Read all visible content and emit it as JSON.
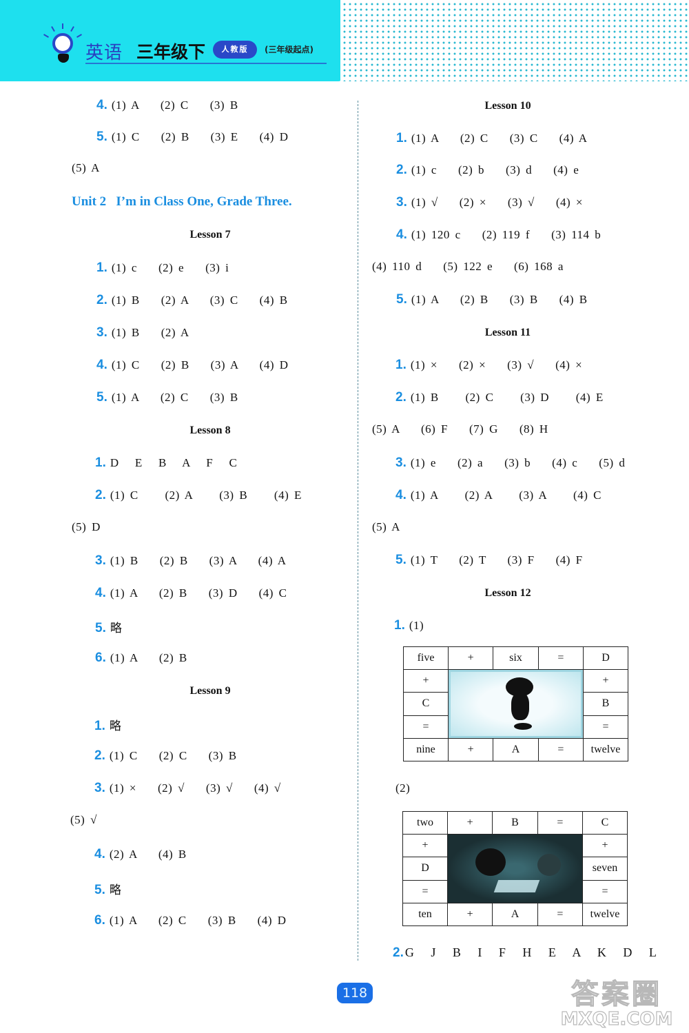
{
  "header": {
    "subject": "英语",
    "grade": "三年级下",
    "edition_badge": "人教版",
    "edition_note": "(三年级起点)",
    "icon": "lightbulb-icon",
    "brand_color": "#1ee0ee",
    "accent_color": "#2a48c8"
  },
  "left": {
    "prev_items": [
      {
        "num": "4.",
        "answer": "(1) A    (2) C    (3) B"
      },
      {
        "num": "5.",
        "answer": "(1) C    (2) B    (3) E    (4) D"
      },
      {
        "num": "",
        "answer": "(5) A"
      }
    ],
    "unit_title": "Unit 2   I’m in Class One, Grade Three.",
    "lesson7": {
      "title": "Lesson 7",
      "items": [
        {
          "num": "1.",
          "answer": "(1) c    (2) e    (3) i"
        },
        {
          "num": "2.",
          "answer": "(1) B    (2) A    (3) C    (4) B"
        },
        {
          "num": "3.",
          "answer": "(1) B    (2) A"
        },
        {
          "num": "4.",
          "answer": "(1) C    (2) B    (3) A    (4) D"
        },
        {
          "num": "5.",
          "answer": "(1) A    (2) C    (3) B"
        }
      ]
    },
    "lesson8": {
      "title": "Lesson 8",
      "items": [
        {
          "num": "1.",
          "answer": "D   E   B   A   F   C"
        },
        {
          "num": "2.",
          "answer": "(1) C     (2) A     (3) B     (4) E"
        },
        {
          "num": "",
          "answer": "(5) D"
        },
        {
          "num": "3.",
          "answer": "(1) B    (2) B    (3) A    (4) A"
        },
        {
          "num": "4.",
          "answer": "(1) A    (2) B    (3) D    (4) C"
        },
        {
          "num": "5.",
          "answer": "略"
        },
        {
          "num": "6.",
          "answer": "(1) A    (2) B"
        }
      ]
    },
    "lesson9": {
      "title": "Lesson 9",
      "items": [
        {
          "num": "1.",
          "answer": "略"
        },
        {
          "num": "2.",
          "answer": "(1) C    (2) C    (3) B"
        },
        {
          "num": "3.",
          "answer": "(1) ×    (2) √    (3) √    (4) √"
        },
        {
          "num": "",
          "answer": "(5) √"
        },
        {
          "num": "4.",
          "answer": "(2) A    (4) B"
        },
        {
          "num": "5.",
          "answer": "略"
        },
        {
          "num": "6.",
          "answer": "(1) A    (2) C    (3) B    (4) D"
        }
      ]
    }
  },
  "right": {
    "lesson10": {
      "title": "Lesson 10",
      "items": [
        {
          "num": "1.",
          "answer": "(1) A    (2) C    (3) C    (4) A"
        },
        {
          "num": "2.",
          "answer": "(1) c    (2) b    (3) d    (4) e"
        },
        {
          "num": "3.",
          "answer": "(1) √    (2) ×    (3) √    (4) ×"
        },
        {
          "num": "4.",
          "answer": "(1) 120 c    (2) 119 f    (3) 114 b"
        },
        {
          "num": "",
          "answer": "(4) 110 d    (5) 122 e    (6) 168 a"
        },
        {
          "num": "5.",
          "answer": "(1) A    (2) B    (3) B    (4) B"
        }
      ]
    },
    "lesson11": {
      "title": "Lesson 11",
      "items": [
        {
          "num": "1.",
          "answer": "(1) ×    (2) ×    (3) √    (4) ×"
        },
        {
          "num": "2.",
          "answer": "(1) B     (2) C     (3) D     (4) E"
        },
        {
          "num": "",
          "answer": "(5) A    (6) F    (7) G    (8) H"
        },
        {
          "num": "3.",
          "answer": "(1) e    (2) a    (3) b    (4) c    (5) d"
        },
        {
          "num": "4.",
          "answer": "(1) A     (2) A     (3) A     (4) C"
        },
        {
          "num": "",
          "answer": "(5) A"
        },
        {
          "num": "5.",
          "answer": "(1) T    (2) T    (3) F    (4) F"
        }
      ]
    },
    "lesson12": {
      "title": "Lesson 12",
      "q1_label_num": "1.",
      "q1_part1": "(1)",
      "q1_part2": "(2)",
      "puzzle1": {
        "top": [
          "five",
          "+",
          "six",
          "=",
          "D"
        ],
        "left": [
          "+",
          "C",
          "="
        ],
        "right": [
          "+",
          "B",
          "="
        ],
        "bottom": [
          "nine",
          "+",
          "A",
          "=",
          "twelve"
        ]
      },
      "puzzle2": {
        "top": [
          "two",
          "+",
          "B",
          "=",
          "C"
        ],
        "left": [
          "+",
          "D",
          "="
        ],
        "right": [
          "+",
          "seven",
          "="
        ],
        "bottom": [
          "ten",
          "+",
          "A",
          "=",
          "twelve"
        ]
      },
      "q2": {
        "num": "2.",
        "answer": "G   J   B   I   F   H   E   A   K   D   L"
      }
    }
  },
  "footer": {
    "page_number": "118",
    "watermark_cn": "答案圈",
    "watermark_en": "MXQE.COM"
  }
}
